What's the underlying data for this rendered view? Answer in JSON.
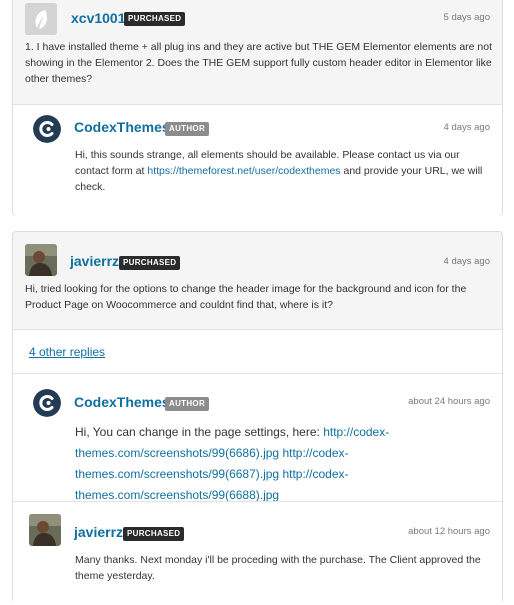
{
  "threads": [
    {
      "comment": {
        "username": "xcv1001",
        "badge": "PURCHASED",
        "time": "5 days ago",
        "text": "1. I have installed theme + all plug ins and they are active but THE GEM Elementor elements are not showing in the Elementor 2. Does the THE GEM support fully custom header editor in Elementor like other themes?",
        "avatar_icon": "leaf-default-avatar-icon"
      },
      "reply": {
        "username": "CodexThemes",
        "badge": "AUTHOR",
        "time": "4 days ago",
        "text_before": "Hi, this sounds strange, all elements should be available. Please contact us via our contact form at ",
        "link": "https://themeforest.net/user/codexthemes",
        "text_after": " and provide your URL, we will check.",
        "avatar_icon": "codex-logo-icon"
      }
    },
    {
      "comment": {
        "username": "javierrz",
        "badge": "PURCHASED",
        "time": "4 days ago",
        "text": "Hi, tried looking for the options to change the header image for the background and icon for the Product Page on Woocommerce and couldnt find that, where is it?"
      },
      "other_replies": "4 other replies",
      "replies": [
        {
          "username": "CodexThemes",
          "badge": "AUTHOR",
          "time": "about 24 hours ago",
          "text_before": "Hi, You can change in the page settings, here: ",
          "links": [
            "http://codex-themes.com/screenshots/99(6686).jpg",
            "http://codex-themes.com/screenshots/99(6687).jpg",
            "http://codex-themes.com/screenshots/99(6688).jpg"
          ]
        },
        {
          "username": "javierrz",
          "badge": "PURCHASED",
          "time": "about 12 hours ago",
          "text": "Many thanks. Next monday i'll be proceding with the purchase. The Client approved the theme yesterday."
        }
      ]
    }
  ],
  "colors": {
    "link": "#0f6f9e",
    "purchased_badge": "#2b2b2b",
    "author_badge": "#8c8c8c"
  }
}
